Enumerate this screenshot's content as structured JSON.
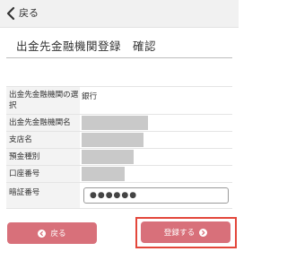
{
  "header": {
    "back_label": "戻る",
    "back_icon": "chevron-left-icon"
  },
  "title": "出金先金融機関登録　確認",
  "form": {
    "rows": [
      {
        "label": "出金先金融機関の選択",
        "value": "銀行"
      },
      {
        "label": "出金先金融機関名",
        "value": ""
      },
      {
        "label": "支店名",
        "value": ""
      },
      {
        "label": "預金種別",
        "value": ""
      },
      {
        "label": "口座番号",
        "value": ""
      },
      {
        "label": "暗証番号",
        "value": "●●●●●●"
      }
    ]
  },
  "buttons": {
    "back": {
      "label": "戻る",
      "icon": "circle-arrow-left-icon"
    },
    "register": {
      "label": "登録する",
      "icon": "circle-arrow-right-icon"
    }
  },
  "colors": {
    "button": "#d8707a",
    "highlight": "#e3473b",
    "redaction": "#c9c9c9"
  }
}
